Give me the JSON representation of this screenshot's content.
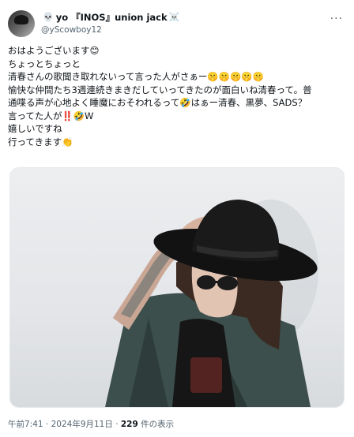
{
  "header": {
    "display_name": "yo 『INOS』union jack",
    "handle": "@yScowboy12",
    "more": "···"
  },
  "body": {
    "lines": [
      "おはようございます😊",
      "ちょっとちょっと",
      "清春さんの歌聞き取れないって言った人がさぁー🤫🤫🤫🤫🤫",
      "愉快な仲間たち3週連続きまきだしていってきたのが面白いね清春って。普",
      "通喋る声が心地よく睡魔におそわれるって🤣はぁー清春、黒夢、SADS？",
      "言ってた人が‼️🤣W",
      "嬉しいですね",
      "行ってきます👏"
    ]
  },
  "meta": {
    "time_date": "午前7:41 · 2024年9月11日 · ",
    "views_count": "229",
    "views_label": " 件の表示"
  }
}
